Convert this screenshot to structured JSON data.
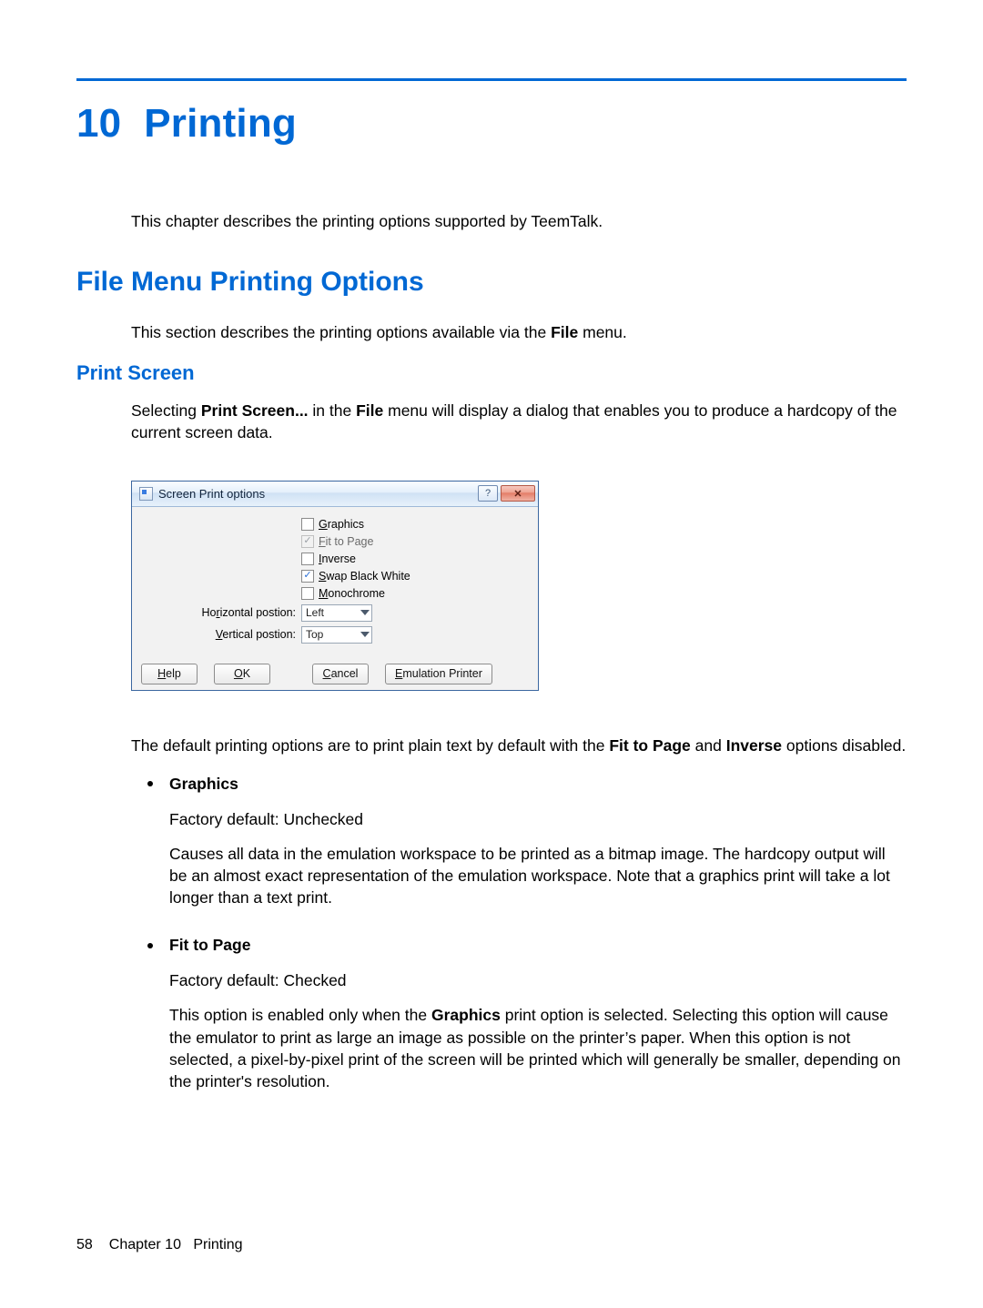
{
  "chapter": {
    "number": "10",
    "title": "Printing",
    "intro": "This chapter describes the printing options supported by TeemTalk."
  },
  "h2": "File Menu Printing Options",
  "section_intro_pre": "This section describes the printing options available via the ",
  "section_intro_bold": "File",
  "section_intro_post": " menu.",
  "h3": "Print Screen",
  "ps_para": {
    "pre": "Selecting ",
    "b1": "Print Screen...",
    "mid1": " in the ",
    "b2": "File",
    "post": " menu will display a dialog that enables you to produce a hardcopy of the current screen data."
  },
  "dialog": {
    "title": "Screen Print options",
    "options": {
      "graphics": {
        "label": "Graphics",
        "checked": false,
        "disabled": false
      },
      "fit": {
        "label": "Fit to Page",
        "checked": true,
        "disabled": true
      },
      "inverse": {
        "label": "Inverse",
        "checked": false,
        "disabled": false
      },
      "swap": {
        "label": "Swap Black White",
        "checked": true,
        "disabled": false
      },
      "mono": {
        "label": "Monochrome",
        "checked": false,
        "disabled": false
      }
    },
    "hpos": {
      "label": "Horizontal postion:",
      "value": "Left"
    },
    "vpos": {
      "label": "Vertical postion:",
      "value": "Top"
    },
    "buttons": {
      "help": "Help",
      "ok": "OK",
      "cancel": "Cancel",
      "emul": "Emulation Printer"
    },
    "help_glyph": "?",
    "close_glyph": "✕"
  },
  "after_dialog": {
    "pre": "The default printing options are to print plain text by default with the ",
    "b1": "Fit to Page",
    "mid": " and ",
    "b2": "Inverse",
    "post": " options disabled."
  },
  "bullets": {
    "graphics": {
      "title": "Graphics",
      "default": "Factory default: Unchecked",
      "desc": "Causes all data in the emulation workspace to be printed as a bitmap image. The hardcopy output will be an almost exact representation of the emulation workspace. Note that a graphics print will take a lot longer than a text print."
    },
    "fit": {
      "title": "Fit to Page",
      "default": "Factory default: Checked",
      "desc_pre": "This option is enabled only when the ",
      "desc_b": "Graphics",
      "desc_post": " print option is selected. Selecting this option will cause the emulator to print as large an image as possible on the printer’s paper. When this option is not selected, a pixel-by-pixel print of the screen will be printed which will generally be smaller, depending on the printer's resolution."
    }
  },
  "footer": {
    "page": "58",
    "chapter": "Chapter 10",
    "title": "Printing"
  }
}
